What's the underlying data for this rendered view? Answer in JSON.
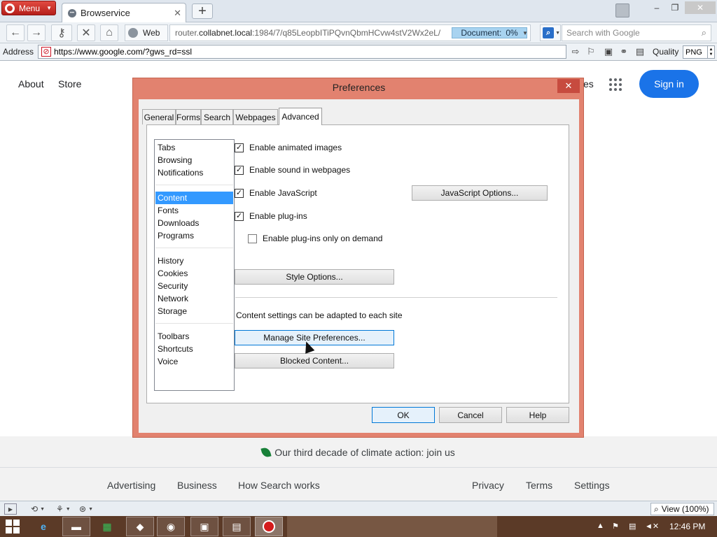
{
  "browser": {
    "menu_label": "Menu",
    "tab_title": "Browservice",
    "close_tab_glyph": "✕",
    "new_tab_glyph": "+",
    "window_min_glyph": "–",
    "window_max_glyph": "❐",
    "window_close_glyph": "✕",
    "web_label": "Web",
    "url_prefix": "router.",
    "url_host": "collabnet.local",
    "url_rest": ":1984/7/q85LeopbITiPQvnQbmHCvw4stV2Wx2eL/",
    "document_label": "Document:",
    "document_progress": "0%",
    "search_placeholder": "Search with Google",
    "address_label": "Address",
    "address_value": "https://www.google.com/?gws_rd=ssl",
    "quality_label": "Quality",
    "quality_value": "PNG",
    "zoom_label": "View (100%)"
  },
  "google": {
    "about": "About",
    "store": "Store",
    "images_partial": "es",
    "sign_in": "Sign in",
    "climate_text": "Our third decade of climate action: join us",
    "footer_left": [
      "Advertising",
      "Business",
      "How Search works"
    ],
    "footer_right": [
      "Privacy",
      "Terms",
      "Settings"
    ]
  },
  "dialog": {
    "title": "Preferences",
    "close_glyph": "✕",
    "tabs": [
      "General",
      "Forms",
      "Search",
      "Webpages",
      "Advanced"
    ],
    "active_tab": "Advanced",
    "categories": {
      "group1": [
        "Tabs",
        "Browsing",
        "Notifications"
      ],
      "group2": [
        "Content",
        "Fonts",
        "Downloads",
        "Programs"
      ],
      "group3": [
        "History",
        "Cookies",
        "Security",
        "Network",
        "Storage"
      ],
      "group4": [
        "Toolbars",
        "Shortcuts",
        "Voice"
      ]
    },
    "selected_category": "Content",
    "checkboxes": [
      {
        "label": "Enable animated images",
        "checked": true
      },
      {
        "label": "Enable sound in webpages",
        "checked": true
      },
      {
        "label": "Enable JavaScript",
        "checked": true
      },
      {
        "label": "Enable plug-ins",
        "checked": true
      },
      {
        "label": "Enable plug-ins only on demand",
        "checked": false
      }
    ],
    "check_glyph": "✓",
    "javascript_options": "JavaScript Options...",
    "style_options": "Style Options...",
    "content_note": "Content settings can be adapted to each site",
    "manage_site_prefs": "Manage Site Preferences...",
    "blocked_content": "Blocked Content...",
    "ok": "OK",
    "cancel": "Cancel",
    "help": "Help"
  },
  "taskbar": {
    "clock": "12:46 PM"
  },
  "colors": {
    "dialog_frame": "#e2826f",
    "selection": "#3399ff",
    "google_blue": "#1a73e8",
    "opera_red": "#d41b1b"
  }
}
